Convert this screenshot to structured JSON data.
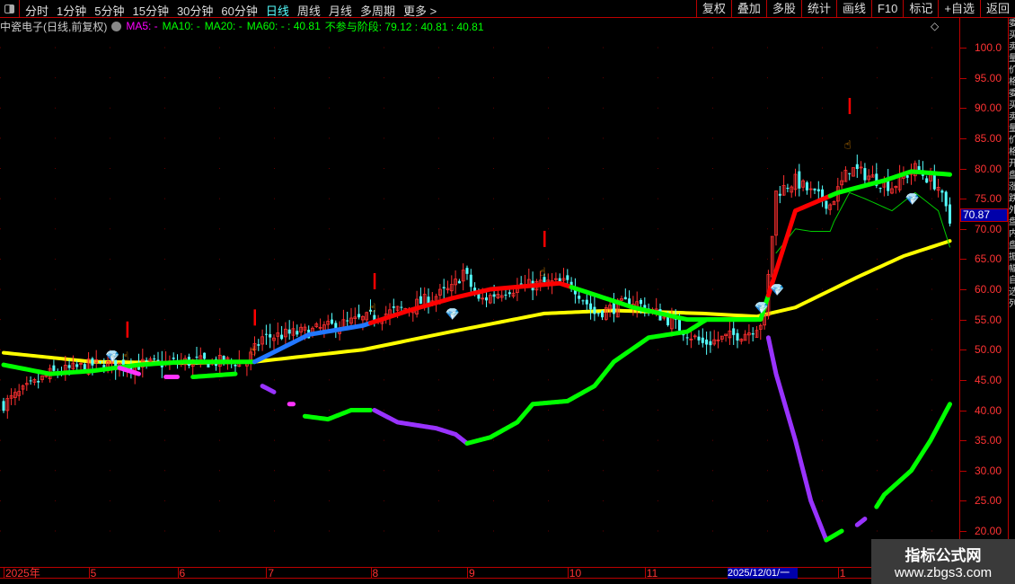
{
  "toolbar": {
    "periods": [
      "分时",
      "1分钟",
      "5分钟",
      "15分钟",
      "30分钟",
      "60分钟",
      "日线",
      "周线",
      "月线",
      "多周期",
      "更多 >"
    ],
    "active_period": "日线",
    "tools": [
      "复权",
      "叠加",
      "多股",
      "统计",
      "画线",
      "F10",
      "标记",
      "+自选",
      "返回"
    ]
  },
  "title": {
    "stock": "中瓷电子(日线,前复权)",
    "ma5": "MA5: -",
    "ma10": "MA10: -",
    "ma20": "MA20: -",
    "ma60": "MA60: - : 40.81",
    "stage": "不参与阶段: 79.12 : 40.81 : 40.81"
  },
  "right_icons": "◇",
  "price_axis": {
    "labels": [
      "100.0",
      "95.00",
      "90.00",
      "85.00",
      "80.00",
      "75.00",
      "70.00",
      "65.00",
      "60.00",
      "55.00",
      "50.00",
      "45.00",
      "40.00",
      "35.00",
      "30.00",
      "25.00",
      "20.00"
    ],
    "current_price": "70.87"
  },
  "time_axis": {
    "labels": [
      {
        "t": "2025年",
        "i": 0
      },
      {
        "t": "5",
        "i": 22
      },
      {
        "t": "6",
        "i": 45
      },
      {
        "t": "7",
        "i": 68
      },
      {
        "t": "8",
        "i": 95
      },
      {
        "t": "9",
        "i": 120
      },
      {
        "t": "10",
        "i": 146
      },
      {
        "t": "11",
        "i": 166
      },
      {
        "t": "1",
        "i": 216
      }
    ],
    "selected": "2025/12/01/一"
  },
  "watermark": {
    "name": "指标公式网",
    "url": "www.zbgs3.com"
  },
  "colors": {
    "up": "#ff3030",
    "down": "#54ffff",
    "ma_yellow": "#ffff00",
    "trend_green": "#00ff00",
    "purple": "#9933ff",
    "magenta": "#ff33ff",
    "blue": "#2277ff"
  },
  "chart_data": {
    "type": "candlestick",
    "ylim": [
      18,
      104
    ],
    "bars": 246,
    "price_path": [
      [
        0,
        41
      ],
      [
        12,
        46
      ],
      [
        23,
        47.5
      ],
      [
        35,
        47.5
      ],
      [
        47,
        48
      ],
      [
        63,
        48
      ],
      [
        67,
        52
      ],
      [
        79,
        53
      ],
      [
        93,
        55
      ],
      [
        105,
        57
      ],
      [
        116,
        60
      ],
      [
        119,
        63
      ],
      [
        123,
        58
      ],
      [
        130,
        60
      ],
      [
        140,
        61
      ],
      [
        147,
        61
      ],
      [
        153,
        56
      ],
      [
        163,
        58
      ],
      [
        172,
        55
      ],
      [
        181,
        51
      ],
      [
        193,
        53
      ],
      [
        197,
        55
      ],
      [
        200,
        76
      ],
      [
        205,
        78
      ],
      [
        209,
        76
      ],
      [
        214,
        74
      ],
      [
        219,
        80
      ],
      [
        223,
        79
      ],
      [
        230,
        77
      ],
      [
        236,
        80
      ],
      [
        242,
        77
      ],
      [
        245,
        71
      ]
    ],
    "yellow_ma": [
      [
        0,
        49.5
      ],
      [
        23,
        48
      ],
      [
        47,
        47.8
      ],
      [
        65,
        48
      ],
      [
        93,
        50
      ],
      [
        116,
        53
      ],
      [
        140,
        56
      ],
      [
        158,
        56.5
      ],
      [
        181,
        56
      ],
      [
        195,
        55.5
      ],
      [
        205,
        57
      ],
      [
        221,
        62
      ],
      [
        233,
        65.5
      ],
      [
        245,
        68
      ]
    ],
    "trend_line": {
      "points": [
        [
          0,
          47.5
        ],
        [
          12,
          46
        ],
        [
          23,
          46.5
        ],
        [
          35,
          47.5
        ],
        [
          47,
          48
        ],
        [
          65,
          48
        ],
        [
          79,
          52.5
        ],
        [
          93,
          54
        ],
        [
          105,
          56.5
        ],
        [
          116,
          58.5
        ],
        [
          126,
          60
        ],
        [
          144,
          61
        ],
        [
          163,
          57
        ],
        [
          177,
          55
        ],
        [
          196,
          55
        ],
        [
          205,
          73
        ],
        [
          216,
          76
        ],
        [
          228,
          78
        ],
        [
          235,
          79.5
        ],
        [
          245,
          79
        ]
      ],
      "color_ranges": [
        [
          0,
          65,
          "#00ff00"
        ],
        [
          65,
          95,
          "#2277ff"
        ],
        [
          95,
          147,
          "#ff0000"
        ],
        [
          147,
          198,
          "#00ff00"
        ],
        [
          198,
          214,
          "#ff0000"
        ],
        [
          214,
          246,
          "#00ff00"
        ]
      ]
    },
    "oscillator": [
      {
        "color": "#ff33ff",
        "points": [
          [
            30,
            47
          ],
          [
            35,
            46
          ]
        ]
      },
      {
        "color": "#ff33ff",
        "points": [
          [
            42,
            45.5
          ],
          [
            45,
            45.5
          ]
        ]
      },
      {
        "color": "#00ff00",
        "points": [
          [
            49,
            45.5
          ],
          [
            60,
            46
          ]
        ]
      },
      {
        "color": "#9933ff",
        "points": [
          [
            67,
            44
          ],
          [
            70,
            43
          ]
        ]
      },
      {
        "color": "#ff33ff",
        "points": [
          [
            74,
            41
          ],
          [
            75,
            41
          ]
        ]
      },
      {
        "color": "#00ff00",
        "points": [
          [
            78,
            39
          ],
          [
            84,
            38.5
          ],
          [
            90,
            40
          ],
          [
            95,
            40
          ]
        ]
      },
      {
        "color": "#9933ff",
        "points": [
          [
            96,
            40
          ],
          [
            102,
            38
          ],
          [
            112,
            37
          ],
          [
            117,
            36
          ],
          [
            120,
            34.5
          ]
        ]
      },
      {
        "color": "#00ff00",
        "points": [
          [
            120,
            34.5
          ],
          [
            126,
            35.5
          ],
          [
            133,
            38
          ],
          [
            137,
            41
          ],
          [
            146,
            41.5
          ],
          [
            153,
            44
          ],
          [
            158,
            48
          ],
          [
            167,
            52
          ],
          [
            177,
            53
          ],
          [
            182,
            55
          ],
          [
            195,
            55
          ]
        ]
      },
      {
        "color": "#9933ff",
        "points": [
          [
            198,
            52
          ],
          [
            200,
            46
          ],
          [
            205,
            35
          ],
          [
            209,
            25
          ],
          [
            213,
            18.5
          ]
        ]
      },
      {
        "color": "#00ff00",
        "points": [
          [
            213,
            18.5
          ],
          [
            217,
            20
          ]
        ]
      },
      {
        "color": "#9933ff",
        "points": [
          [
            221,
            21
          ],
          [
            223,
            22
          ]
        ]
      },
      {
        "color": "#00ff00",
        "points": [
          [
            226,
            24
          ],
          [
            228,
            26
          ],
          [
            235,
            30
          ],
          [
            240,
            35
          ],
          [
            245,
            41
          ]
        ]
      }
    ],
    "signals": [
      {
        "i": 32,
        "v": 52
      },
      {
        "i": 65,
        "v": 54
      },
      {
        "i": 96,
        "v": 60
      },
      {
        "i": 140,
        "v": 67
      },
      {
        "i": 219,
        "v": 89
      }
    ],
    "hands": [
      {
        "i": 32,
        "v": 49
      },
      {
        "i": 65,
        "v": 50
      },
      {
        "i": 96,
        "v": 57
      },
      {
        "i": 140,
        "v": 63
      },
      {
        "i": 219,
        "v": 84
      }
    ],
    "diamonds": [
      {
        "i": 28,
        "v": 49
      },
      {
        "i": 116,
        "v": 56
      },
      {
        "i": 196,
        "v": 57
      },
      {
        "i": 200,
        "v": 60
      },
      {
        "i": 235,
        "v": 75
      }
    ]
  }
}
